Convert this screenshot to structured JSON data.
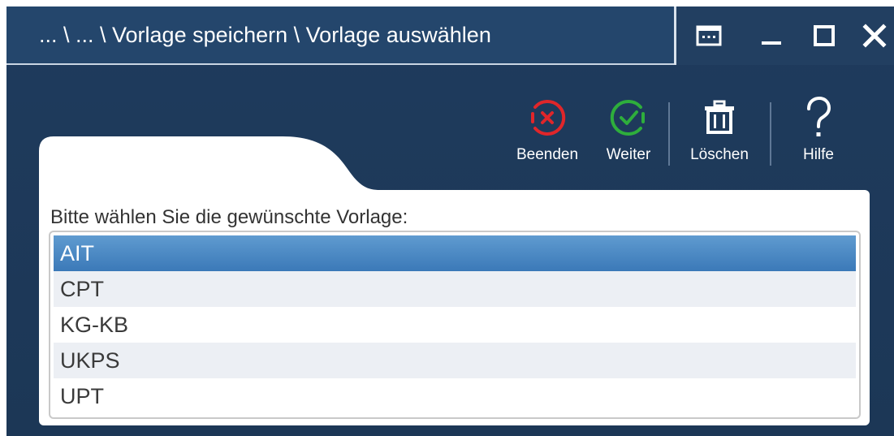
{
  "window": {
    "title": "... \\ ... \\ Vorlage speichern \\ Vorlage auswählen",
    "controls": [
      {
        "name": "keyboard",
        "icon": "keyboard-icon"
      },
      {
        "name": "minimize",
        "icon": "minimize-icon"
      },
      {
        "name": "maximize",
        "icon": "maximize-icon"
      },
      {
        "name": "close",
        "icon": "close-icon"
      }
    ]
  },
  "toolbar": {
    "beenden": {
      "label": "Beenden",
      "icon": "x-circle-icon",
      "color": "#e0262a"
    },
    "weiter": {
      "label": "Weiter",
      "icon": "check-circle-icon",
      "color": "#2eae3c"
    },
    "loeschen": {
      "label": "Löschen",
      "icon": "trash-icon",
      "color": "#ffffff"
    },
    "hilfe": {
      "label": "Hilfe",
      "icon": "question-icon",
      "color": "#ffffff"
    }
  },
  "main": {
    "prompt": "Bitte wählen Sie die gewünschte Vorlage:",
    "templates": [
      {
        "label": "AIT",
        "selected": true
      },
      {
        "label": "CPT",
        "selected": false
      },
      {
        "label": "KG-KB",
        "selected": false
      },
      {
        "label": "UKPS",
        "selected": false
      },
      {
        "label": "UPT",
        "selected": false
      }
    ]
  },
  "colors": {
    "window_bg": "#1f3b5d",
    "selection": "#4a88c4",
    "alt_row": "#eceff4"
  }
}
